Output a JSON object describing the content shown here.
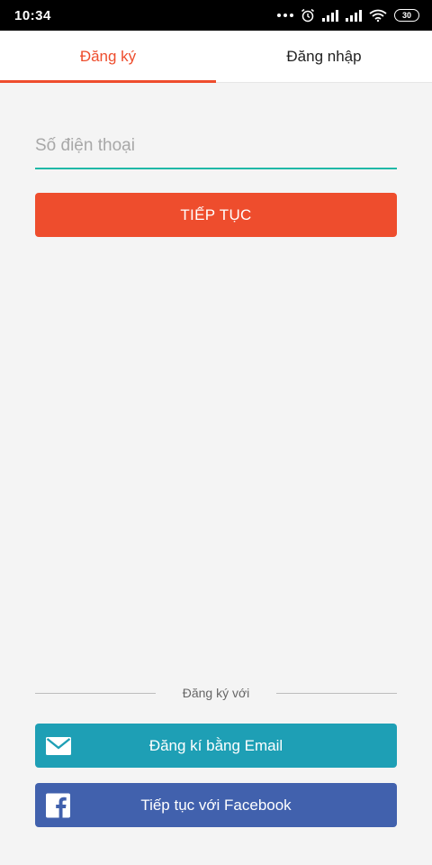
{
  "status_bar": {
    "time": "10:34",
    "battery": "30"
  },
  "tabs": [
    {
      "label": "Đăng ký",
      "active": true
    },
    {
      "label": "Đăng nhập",
      "active": false
    }
  ],
  "form": {
    "phone_placeholder": "Số điện thoại",
    "phone_value": "",
    "continue_label": "TIẾP TỤC"
  },
  "social": {
    "divider_text": "Đăng ký với",
    "email_label": "Đăng kí bằng Email",
    "email_icon": "envelope-icon",
    "facebook_label": "Tiếp tục với Facebook",
    "facebook_icon": "facebook-icon"
  },
  "colors": {
    "accent": "#ee4d2d",
    "input_underline": "#1fb8a6",
    "email_button": "#1e9fb5",
    "facebook_button": "#4161ad"
  }
}
